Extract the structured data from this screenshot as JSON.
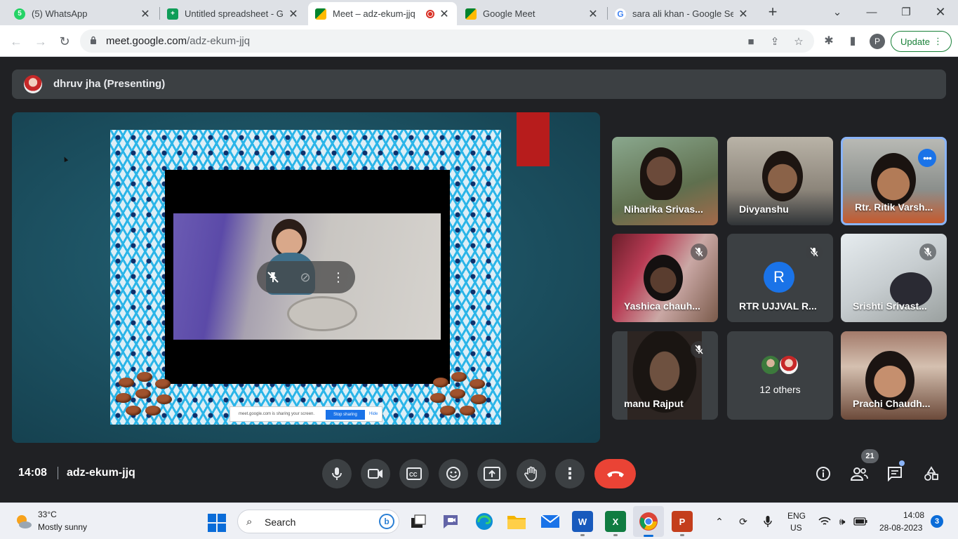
{
  "browser": {
    "tabs": [
      {
        "title": "(5) WhatsApp"
      },
      {
        "title": "Untitled spreadsheet - Go"
      },
      {
        "title": "Meet – adz-ekum-jjq"
      },
      {
        "title": "Google Meet"
      },
      {
        "title": "sara ali khan - Google Sea"
      }
    ],
    "whatsapp_badge": "5",
    "url_host": "meet.google.com",
    "url_path": "/adz-ekum-jjq",
    "profile_initial": "P",
    "update_label": "Update"
  },
  "meet": {
    "presenter_label": "dhruv jha (Presenting)",
    "share_strip": {
      "text": "meet.google.com is sharing your screen.",
      "stop_label": "Stop sharing",
      "hide_label": "Hide"
    },
    "participants": [
      {
        "name": "Niharika Srivas..."
      },
      {
        "name": "Divyanshu"
      },
      {
        "name": "Rtr. Ritik Varsh..."
      },
      {
        "name": "Yashica chauh..."
      },
      {
        "name": "RTR UJJVAL R...",
        "initial": "R"
      },
      {
        "name": "Srishti Srivast..."
      },
      {
        "name": "manu Rajput"
      },
      {
        "name": "12 others"
      },
      {
        "name": "Prachi Chaudh..."
      }
    ],
    "time": "14:08",
    "meeting_code": "adz-ekum-jjq",
    "participant_count": "21",
    "colors": {
      "end_call": "#ea4335",
      "accent": "#1a73e8"
    }
  },
  "taskbar": {
    "weather_temp": "33°C",
    "weather_desc": "Mostly sunny",
    "search_label": "Search",
    "lang_line1": "ENG",
    "lang_line2": "US",
    "time": "14:08",
    "date": "28-08-2023",
    "notification_count": "3"
  }
}
